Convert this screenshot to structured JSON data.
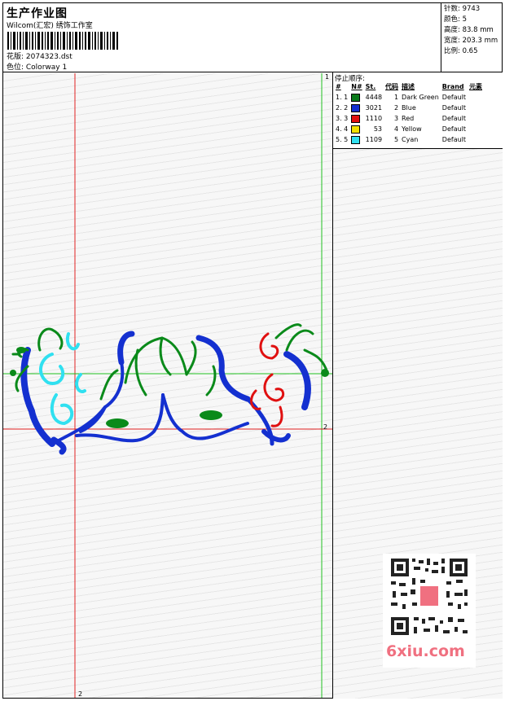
{
  "header": {
    "title": "生产作业图",
    "company": "Wilcom(汇宏) 绣饰工作室",
    "design_label": "花版: 2074323.dst",
    "colorway_label": "色位: Colorway 1"
  },
  "stats": {
    "stitches": "针数: 9743",
    "colors": "颜色: 5",
    "height": "高度: 83.8 mm",
    "width": "宽度: 203.3 mm",
    "scale": "比例: 0.65"
  },
  "stop_sequence": {
    "label": "停止顺序:",
    "headers": [
      "#",
      "N#",
      "St.",
      "代码",
      "描述",
      "Brand",
      "元素"
    ],
    "rows": [
      {
        "idx": "1. 1",
        "color": "#0a7a1a",
        "code": "4448",
        "st": "1",
        "desc": "Dark Green",
        "brand": "Default"
      },
      {
        "idx": "2. 2",
        "color": "#1430d0",
        "code": "3021",
        "st": "2",
        "desc": "Blue",
        "brand": "Default"
      },
      {
        "idx": "3. 3",
        "color": "#e01010",
        "code": "1110",
        "st": "3",
        "desc": "Red",
        "brand": "Default"
      },
      {
        "idx": "4. 4",
        "color": "#f0e000",
        "code": "53",
        "st": "4",
        "desc": "Yellow",
        "brand": "Default"
      },
      {
        "idx": "5. 5",
        "color": "#30e0f0",
        "code": "1109",
        "st": "5",
        "desc": "Cyan",
        "brand": "Default"
      }
    ]
  },
  "guides": {
    "label_1": "1",
    "label_2": "2",
    "label_2b": "2"
  },
  "watermark": {
    "text": "6xiu.com"
  }
}
